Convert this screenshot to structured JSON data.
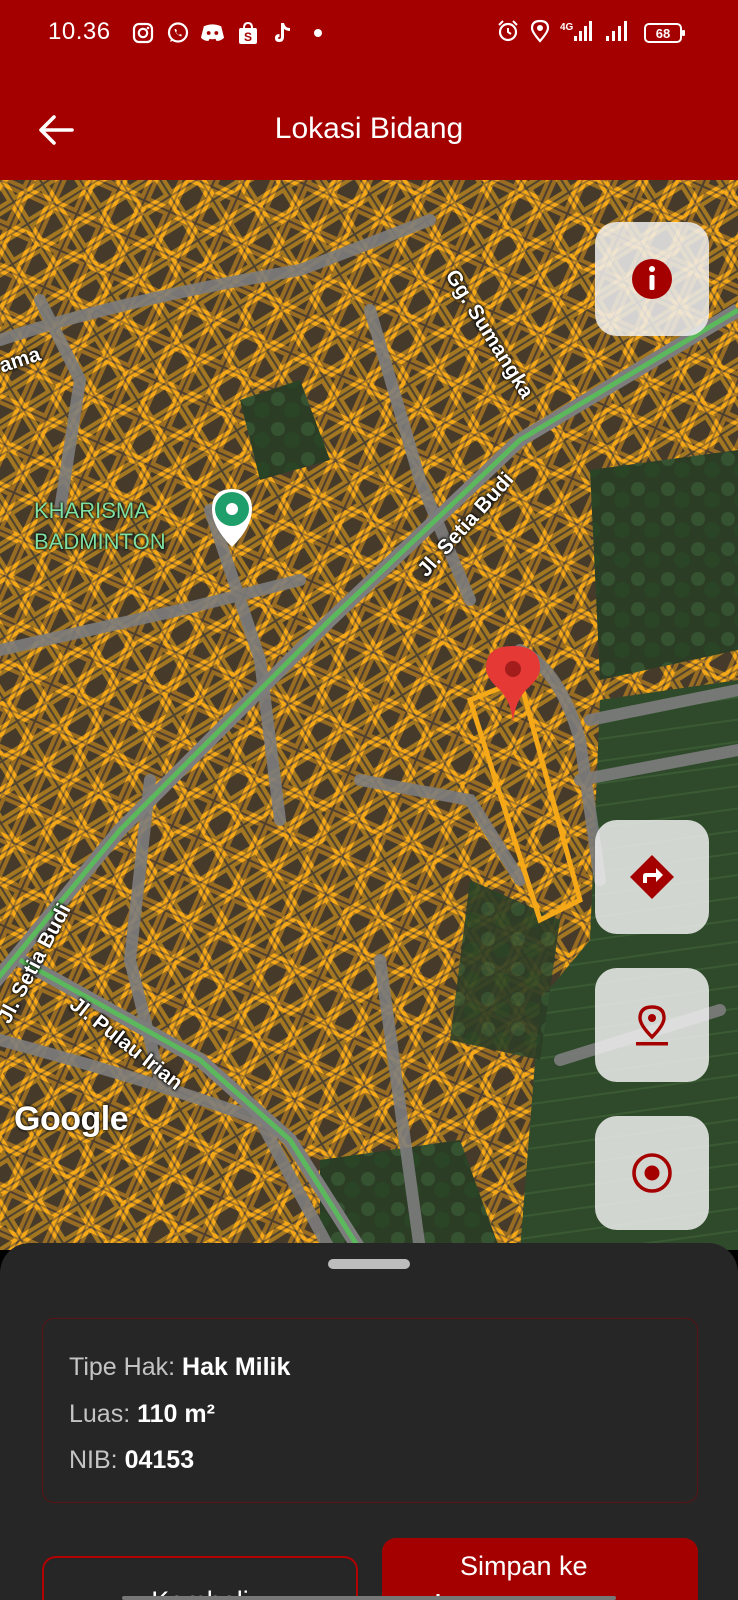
{
  "status_bar": {
    "time": "10.36",
    "battery": "68",
    "notification_icons": [
      "instagram-icon",
      "whatsapp-icon",
      "discord-icon",
      "shopee-icon",
      "tiktok-icon",
      "dot-icon"
    ],
    "system_icons": [
      "alarm-icon",
      "location-icon",
      "signal-4g-icon",
      "signal-icon",
      "battery-icon"
    ]
  },
  "app_bar": {
    "title": "Lokasi Bidang",
    "back_icon": "arrow-left-icon"
  },
  "map": {
    "street_labels": [
      "Gg. Sumangka",
      "Jl. Setia Budi",
      "Jl. Setia Budi",
      "Jl. Pulau Irian",
      "ama"
    ],
    "poi_label_line1": "KHARISMA",
    "poi_label_line2": "BADMINTON",
    "attribution": "Google",
    "pin_icon": "map-pin-icon",
    "poi_icon": "poi-pin-icon",
    "colors": {
      "parcel_outline": "#f5a818",
      "road": "#8a8a8a",
      "main_road_traffic": "#5cb85c",
      "marker": "#e53935"
    }
  },
  "map_controls": {
    "info_icon": "info-icon",
    "directions_icon": "directions-icon",
    "place_icon": "place-marker-icon",
    "my_location_icon": "my-location-icon"
  },
  "sheet": {
    "tipe_hak_label": "Tipe Hak:",
    "tipe_hak_value": "Hak Milik",
    "luas_label": "Luas:",
    "luas_value": "110 m²",
    "nib_label": "NIB:",
    "nib_value": "04153",
    "back_button": "Kembali",
    "save_button": "Simpan ke",
    "save_icon": "bookmark-add-icon"
  },
  "colors": {
    "primary": "#a50000",
    "sheet_bg": "#262626",
    "fab_bg": "#eeeeee"
  }
}
